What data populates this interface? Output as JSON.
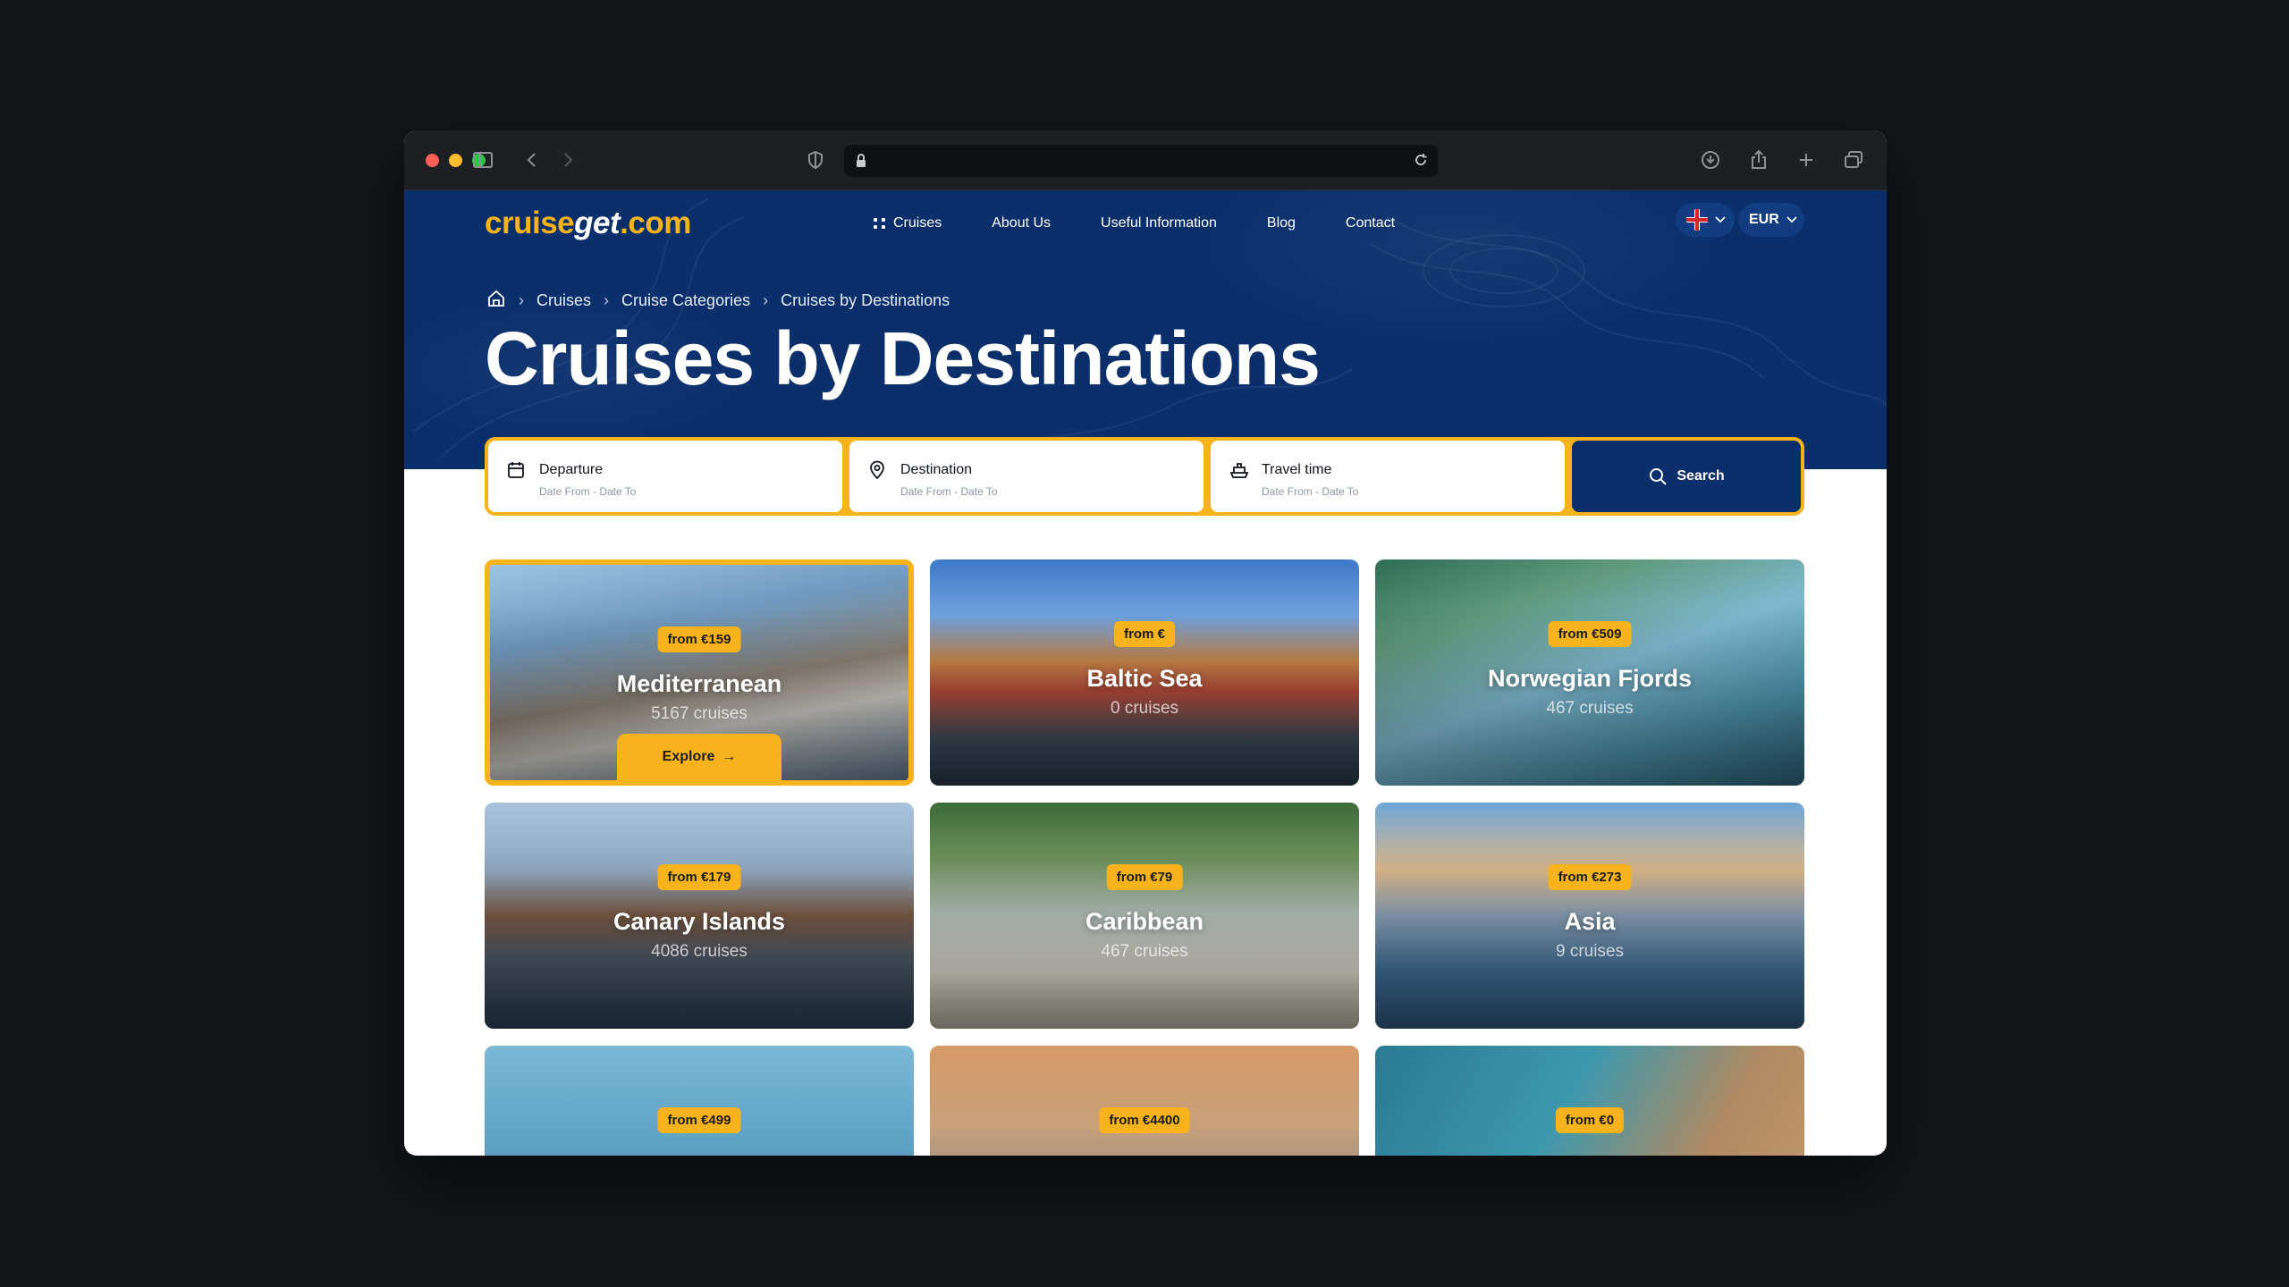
{
  "browser": {
    "url": ""
  },
  "site": {
    "logo_prefix": "cruise",
    "logo_mid": "get",
    "logo_suffix": ".com",
    "nav": [
      {
        "label": "Cruises"
      },
      {
        "label": "About Us"
      },
      {
        "label": "Useful Information"
      },
      {
        "label": "Blog"
      },
      {
        "label": "Contact"
      }
    ],
    "language": "English (UK flag)",
    "currency": "EUR"
  },
  "breadcrumb": [
    "Cruises",
    "Cruise Categories",
    "Cruises by Destinations"
  ],
  "page_title": "Cruises by Destinations",
  "search": {
    "departure": {
      "label": "Departure",
      "sub": "Date From - Date To"
    },
    "destination": {
      "label": "Destination",
      "sub": "Date From - Date To"
    },
    "travel_time": {
      "label": "Travel time",
      "sub": "Date From - Date To"
    },
    "button": "Search"
  },
  "destinations": [
    {
      "name": "Mediterranean",
      "price": "from €159",
      "count": "5167 cruises",
      "action": "Explore",
      "active": true
    },
    {
      "name": "Baltic Sea",
      "price": "from €",
      "count": "0 cruises"
    },
    {
      "name": "Norwegian Fjords",
      "price": "from €509",
      "count": "467 cruises"
    },
    {
      "name": "Canary Islands",
      "price": "from €179",
      "count": "4086 cruises"
    },
    {
      "name": "Caribbean",
      "price": "from €79",
      "count": "467 cruises"
    },
    {
      "name": "Asia",
      "price": "from €273",
      "count": "9 cruises"
    },
    {
      "name": "",
      "price": "from €499",
      "count": ""
    },
    {
      "name": "",
      "price": "from €4400",
      "count": ""
    },
    {
      "name": "",
      "price": "from €0",
      "count": ""
    }
  ],
  "colors": {
    "brand_navy": "#0a2f6b",
    "brand_yellow": "#f6b31b",
    "page_bg": "#131519"
  }
}
